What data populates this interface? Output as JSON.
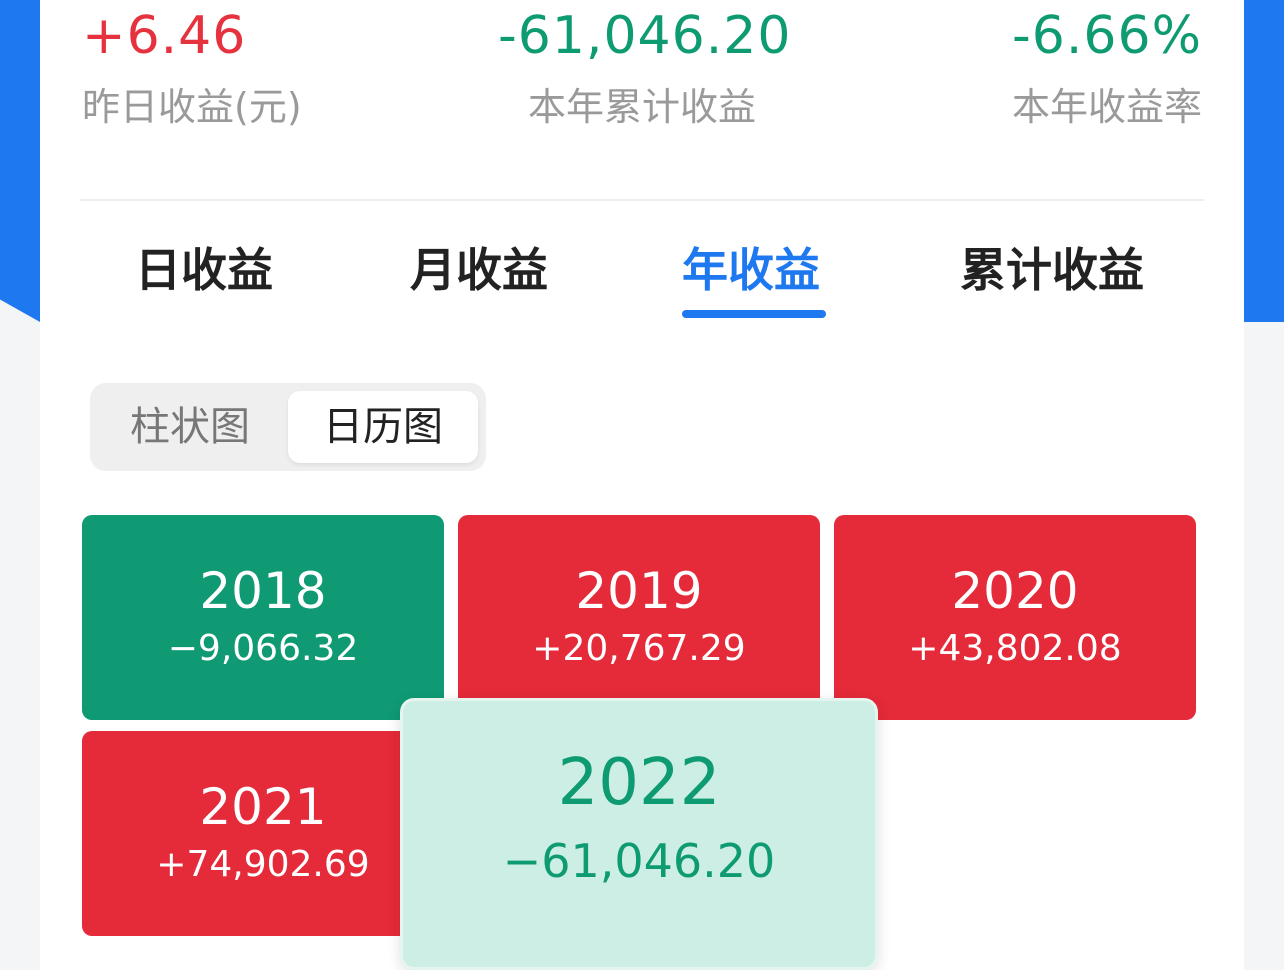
{
  "summary": {
    "yesterday": {
      "value": "+6.46",
      "label": "昨日收益(元)"
    },
    "ytd": {
      "value": "-61,046.20",
      "label": "本年累计收益"
    },
    "rate": {
      "value": "-6.66%",
      "label": "本年收益率"
    }
  },
  "tabs": [
    {
      "label": "日收益"
    },
    {
      "label": "月收益"
    },
    {
      "label": "年收益",
      "active": true
    },
    {
      "label": "累计收益"
    }
  ],
  "view_toggle": {
    "bar_label": "柱状图",
    "calendar_label": "日历图",
    "selected": "日历图"
  },
  "years": [
    {
      "year": "2018",
      "amount": "−9,066.32",
      "trend": "loss"
    },
    {
      "year": "2019",
      "amount": "+20,767.29",
      "trend": "gain"
    },
    {
      "year": "2020",
      "amount": "+43,802.08",
      "trend": "gain"
    },
    {
      "year": "2021",
      "amount": "+74,902.69",
      "trend": "gain"
    },
    {
      "year": "2022",
      "amount": "−61,046.20",
      "trend": "loss",
      "highlighted": true
    }
  ],
  "colors": {
    "accent": "#1e78f0",
    "gain": "#e52a3a",
    "loss": "#0f9a74",
    "highlight_bg": "#cdeee5"
  }
}
